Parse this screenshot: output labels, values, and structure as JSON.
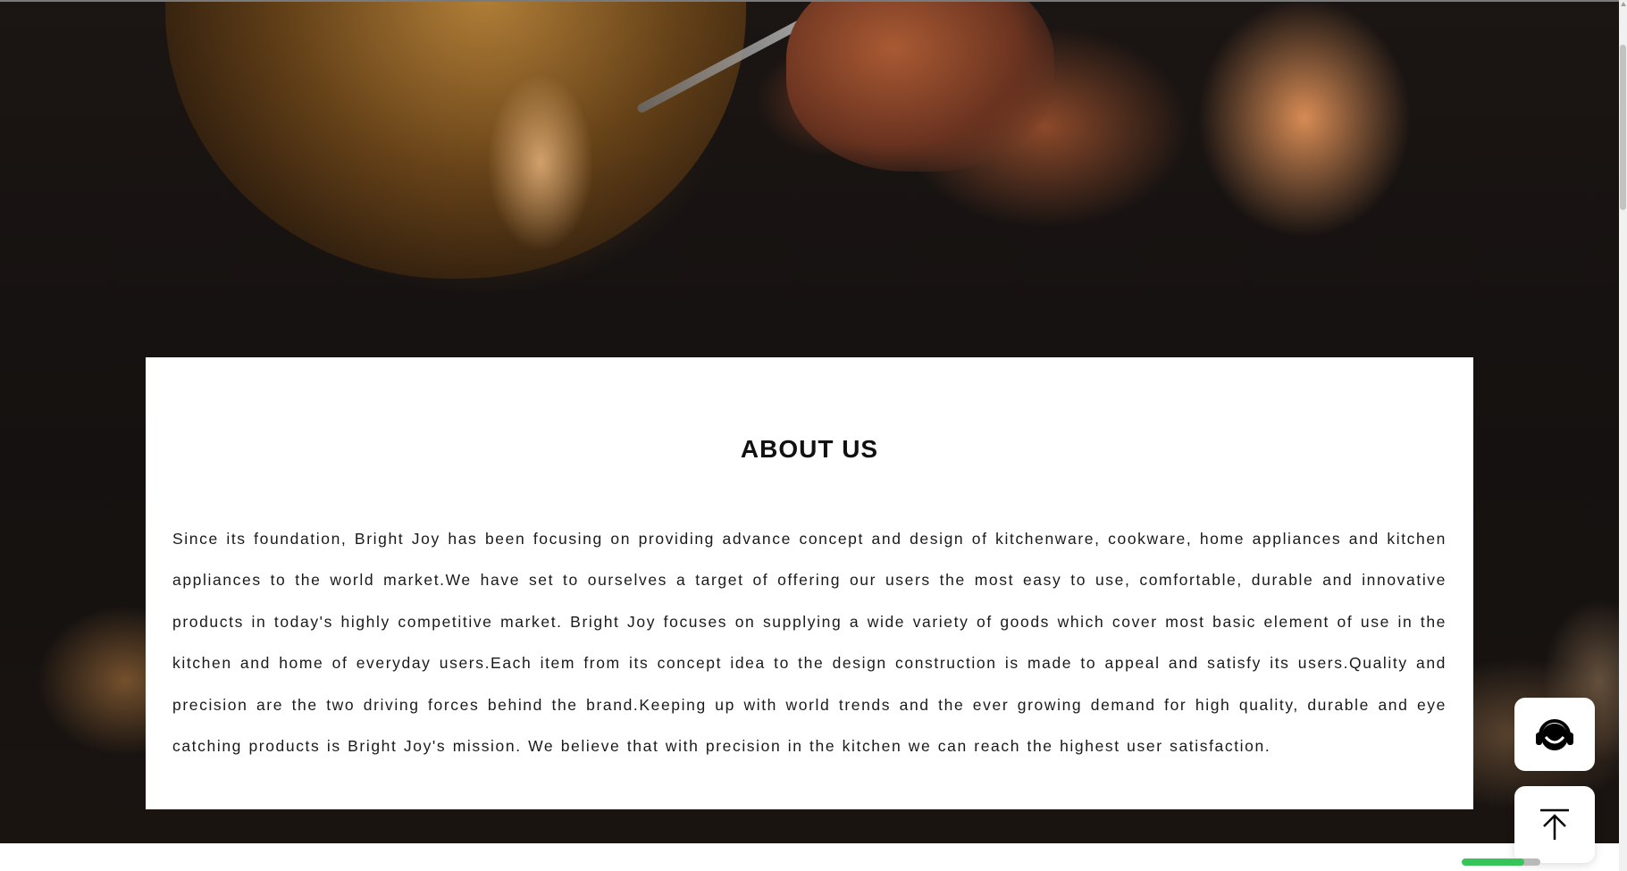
{
  "about": {
    "title": "ABOUT US",
    "body": "Since its foundation, Bright Joy has been focusing on providing advance concept and design of kitchenware, cookware, home appliances and kitchen appliances to the world market.We have set to ourselves a target of offering our users the most easy to use, comfortable, durable and innovative products in today's highly competitive market. Bright Joy focuses on supplying a wide variety of goods which cover most basic element of use in the kitchen and home of everyday users.Each item from its concept idea to the design construction is made to appeal and satisfy its users.Quality and precision are the two driving forces behind the brand.Keeping up with world trends and the ever growing demand for high quality, durable and eye catching products is Bright Joy's mission. We believe that with precision in the kitchen we can reach the highest user satisfaction."
  },
  "floating": {
    "support_icon": "headset-icon",
    "top_icon": "arrow-up-to-top-icon"
  },
  "progress": {
    "fraction": 0.8,
    "color_fill": "#37c458",
    "color_track": "#b9b9b9"
  },
  "colors": {
    "card_background": "#ffffff",
    "text": "#1a1a1a"
  }
}
